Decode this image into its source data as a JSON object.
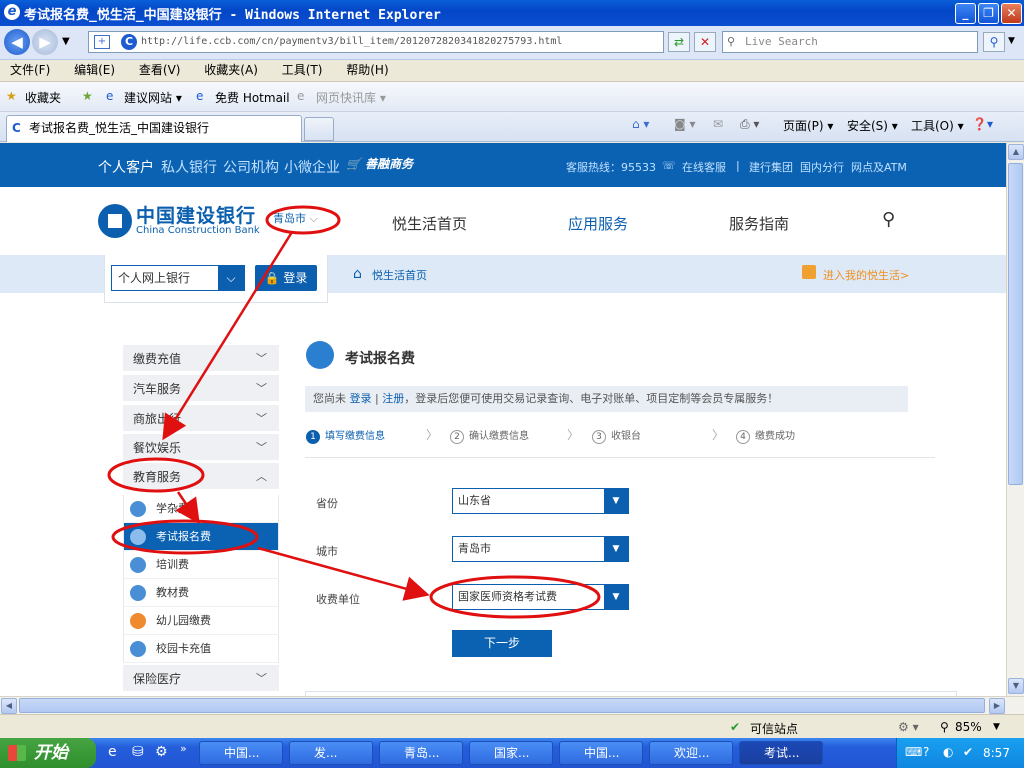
{
  "window": {
    "title": "考试报名费_悦生活_中国建设银行 - Windows Internet Explorer",
    "title_icon": "ie-icon",
    "controls": [
      "minimize-icon",
      "restore-icon",
      "close-icon"
    ]
  },
  "addressbar": {
    "url": "http://life.ccb.com/cn/paymentv3/bill_item/201207282034182027579З.html",
    "search_placeholder": "Live Search"
  },
  "menu": [
    "文件(F)",
    "编辑(E)",
    "查看(V)",
    "收藏夹(A)",
    "工具(T)",
    "帮助(H)"
  ],
  "favorites": {
    "label": "收藏夹",
    "items": [
      "建议网站 ▾",
      "免费 Hotmail",
      "网页快讯库 ▾"
    ]
  },
  "tab": {
    "title": "考试报名费_悦生活_中国建设银行"
  },
  "commandbar": {
    "page": "页面(P) ▾",
    "safety": "安全(S) ▾",
    "tools": "工具(O) ▾"
  },
  "site": {
    "topnav": [
      "个人客户",
      "私人银行",
      "公司机构",
      "小微企业",
      "善融商务"
    ],
    "hotline": "客服热线：95533",
    "online_service": "在线客服",
    "links": [
      "建行集团",
      "国内分行",
      "网点及ATM"
    ],
    "logo_cn": "中国建设银行",
    "logo_en": "China Construction Bank",
    "city": "青岛市",
    "mainnav": [
      "悦生活首页",
      "应用服务",
      "服务指南"
    ],
    "login_select": "个人网上银行",
    "login_button": "登录",
    "breadcrumb": "悦生活首页",
    "my_life": "进入我的悦生活>"
  },
  "sidebar": {
    "categories": [
      "缴费充值",
      "汽车服务",
      "商旅出行",
      "餐饮娱乐",
      "教育服务"
    ],
    "education_items": [
      "学杂费",
      "考试报名费",
      "培训费",
      "教材费",
      "幼儿园缴费",
      "校园卡充值"
    ],
    "after": "保险医疗"
  },
  "main": {
    "title": "考试报名费",
    "notice_prefix": "您尚未",
    "notice_login": "登录",
    "notice_sep": "|",
    "notice_register": "注册",
    "notice_rest": "，登录后您便可使用交易记录查询、电子对账单、项目定制等会员专属服务！",
    "steps": [
      {
        "n": "1",
        "label": "填写缴费信息"
      },
      {
        "n": "2",
        "label": "确认缴费信息"
      },
      {
        "n": "3",
        "label": "收银台"
      },
      {
        "n": "4",
        "label": "缴费成功"
      }
    ],
    "fields": {
      "province_label": "省份",
      "province_value": "山东省",
      "city_label": "城市",
      "city_value": "青岛市",
      "unit_label": "收费单位",
      "unit_value": "国家医师资格考试费"
    },
    "next_button": "下一步"
  },
  "statusbar": {
    "zone": "可信站点",
    "zoom": "85%"
  },
  "taskbar": {
    "start": "开始",
    "tasks": [
      "中国...",
      "发...",
      "青岛...",
      "国家...",
      "中国...",
      "欢迎...",
      "考试..."
    ],
    "clock": "8:57"
  }
}
